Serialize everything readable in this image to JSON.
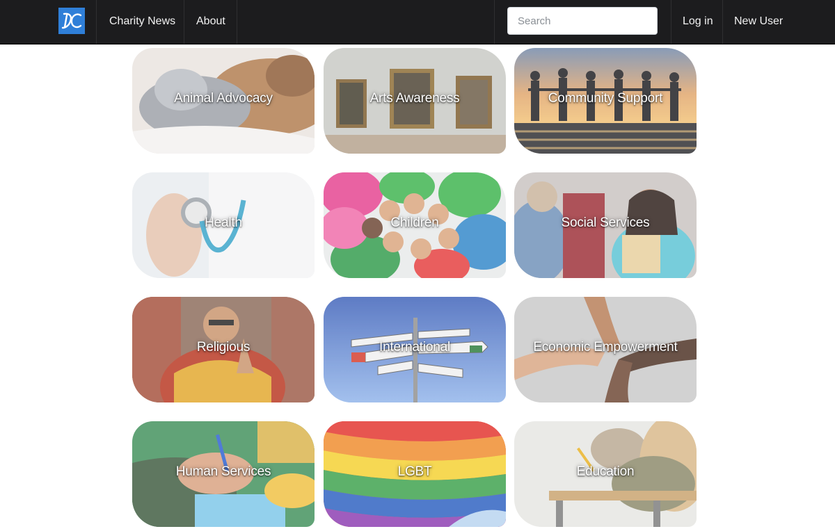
{
  "navbar": {
    "logo_text": "DC",
    "links": [
      {
        "label": "Charity News"
      },
      {
        "label": "About"
      }
    ],
    "search_placeholder": "Search",
    "login_label": "Log in",
    "new_user_label": "New User"
  },
  "categories": [
    {
      "label": "Animal Advocacy",
      "image": "kitten-and-puppy"
    },
    {
      "label": "Arts Awareness",
      "image": "gallery-paintings"
    },
    {
      "label": "Community Support",
      "image": "people-silhouette-sunset"
    },
    {
      "label": "Health",
      "image": "doctor-stethoscope"
    },
    {
      "label": "Children",
      "image": "children-circle"
    },
    {
      "label": "Social Services",
      "image": "social-worker-clipboard"
    },
    {
      "label": "Religious",
      "image": "monk-praying"
    },
    {
      "label": "International",
      "image": "country-signpost"
    },
    {
      "label": "Economic Empowerment",
      "image": "joined-hands"
    },
    {
      "label": "Human Services",
      "image": "hands-writing"
    },
    {
      "label": "LGBT",
      "image": "rainbow-flag"
    },
    {
      "label": "Education",
      "image": "students-exam"
    }
  ],
  "colors": {
    "navbar_bg": "#1c1c1e",
    "logo_bg": "#2f7fd8",
    "nav_text": "#f2f2f2"
  }
}
